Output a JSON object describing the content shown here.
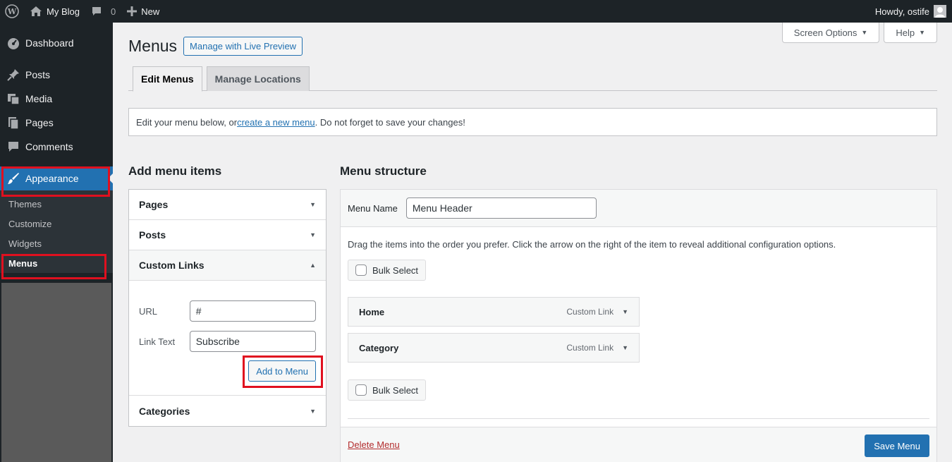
{
  "admin_bar": {
    "site_name": "My Blog",
    "comment_count": "0",
    "new_label": "New",
    "howdy": "Howdy, ostife"
  },
  "sidebar": {
    "items": [
      {
        "label": "Dashboard",
        "icon": "dashboard-icon"
      },
      {
        "label": "Posts",
        "icon": "pin-icon"
      },
      {
        "label": "Media",
        "icon": "media-icon"
      },
      {
        "label": "Pages",
        "icon": "pages-icon"
      },
      {
        "label": "Comments",
        "icon": "comment-icon"
      },
      {
        "label": "Appearance",
        "icon": "brush-icon"
      }
    ],
    "submenu": [
      "Themes",
      "Customize",
      "Widgets",
      "Menus"
    ]
  },
  "screen_options": {
    "screen_options_label": "Screen Options",
    "help_label": "Help"
  },
  "page": {
    "title": "Menus",
    "live_preview": "Manage with Live Preview",
    "tabs": [
      "Edit Menus",
      "Manage Locations"
    ]
  },
  "notice": {
    "before": "Edit your menu below, or ",
    "link": "create a new menu",
    "after": ". Do not forget to save your changes!"
  },
  "add_items": {
    "heading": "Add menu items",
    "sections": [
      "Pages",
      "Posts",
      "Custom Links",
      "Categories"
    ],
    "url_label": "URL",
    "url_value": "#",
    "link_text_label": "Link Text",
    "link_text_value": "Subscribe",
    "add_button": "Add to Menu"
  },
  "structure": {
    "heading": "Menu structure",
    "menu_name_label": "Menu Name",
    "menu_name_value": "Menu Header",
    "instructions": "Drag the items into the order you prefer. Click the arrow on the right of the item to reveal additional configuration options.",
    "bulk_select": "Bulk Select",
    "items": [
      {
        "title": "Home",
        "type": "Custom Link"
      },
      {
        "title": "Category",
        "type": "Custom Link"
      }
    ],
    "delete_menu": "Delete Menu",
    "save_menu": "Save Menu"
  },
  "colors": {
    "accent": "#2271b1",
    "admin_bg": "#1d2327",
    "highlight": "#e0101f",
    "delete": "#b32d2e"
  }
}
